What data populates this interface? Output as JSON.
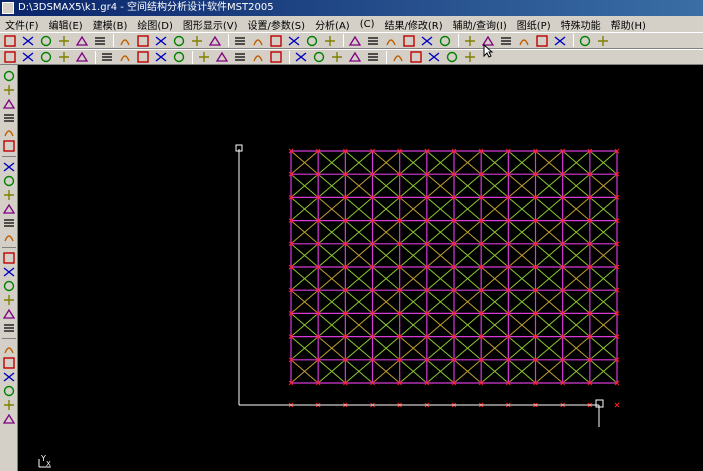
{
  "window": {
    "title": "D:\\3DSMAX5\\k1.gr4 - 空间结构分析设计软件MST2005"
  },
  "menu": [
    "文件(F)",
    "编辑(E)",
    "建模(B)",
    "绘图(D)",
    "图形显示(V)",
    "设置/参数(S)",
    "分析(A)",
    "(C)",
    "结果/修改(R)",
    "辅助/查询(I)",
    "图纸(P)",
    "特殊功能",
    "帮助(H)"
  ],
  "toolbar1_icons": [
    "new-icon",
    "open-icon",
    "save-icon",
    "cut-icon",
    "copy-icon",
    "paste-icon",
    "print-icon",
    "help-icon",
    "pointer-icon",
    "zoom-window-icon",
    "k-icon",
    "rect-icon",
    "zoom-in-icon",
    "zoom-out-icon",
    "pan-icon",
    "rotate-icon",
    "zoom-all-icon",
    "zoom-extent-icon",
    "query-icon",
    "measure-icon",
    "grid-icon",
    "truss-icon",
    "table-icon",
    "plan-icon",
    "chart-icon",
    "section-icon",
    "member-icon",
    "delete-icon",
    "undo-icon",
    "redo-icon",
    "arrow-up-icon",
    "close-icon"
  ],
  "toolbar2_icons": [
    "node-icon",
    "line-icon",
    "diag-icon",
    "grid-line-icon",
    "arc-icon",
    "polyline-icon",
    "text-a-icon",
    "dim-icon",
    "rotate-small-icon",
    "mirror-icon",
    "copy-array-icon",
    "move-icon",
    "scale-icon",
    "crosshair-icon",
    "double-arrow-icon",
    "support-icon",
    "load-icon",
    "force-icon",
    "wave-icon",
    "moment-icon",
    "pin-icon",
    "spring-icon",
    "joint-icon",
    "list-icon",
    "settings-icon"
  ],
  "left_toolbar_icons": [
    "node-tool-icon",
    "move-tool-icon",
    "link-tool-icon",
    "split-tool-icon",
    "merge-tool-icon",
    "cross-tool-icon",
    "diag-tool-icon",
    "copy-tool-icon",
    "measure-tool-icon",
    "array-tool-icon",
    "cylinder-tool-icon",
    "box-tool-icon",
    "monitor-tool-icon",
    "eraser-tool-icon",
    "chain-tool-icon",
    "zigzag-tool-icon",
    "slash-tool-icon",
    "line-tool-icon",
    "star-tool-icon",
    "dash-tool-icon",
    "angle-tool-icon",
    "curve-tool-icon",
    "stack-tool-icon",
    "bars-tool-icon"
  ],
  "model": {
    "grid_columns": 13,
    "grid_rows": 11
  },
  "colors": {
    "background": "#000000",
    "chrome": "#d4d0c8",
    "title_start": "#0a246a",
    "title_end": "#3a6ea5",
    "chord_member": "#d83ad8",
    "web_member": "#8cc832",
    "web_member_alt": "#c0a030",
    "node": "#ff2020",
    "axis": "#ffffff"
  },
  "ucs": {
    "y_label": "Y",
    "x_label": "X"
  }
}
